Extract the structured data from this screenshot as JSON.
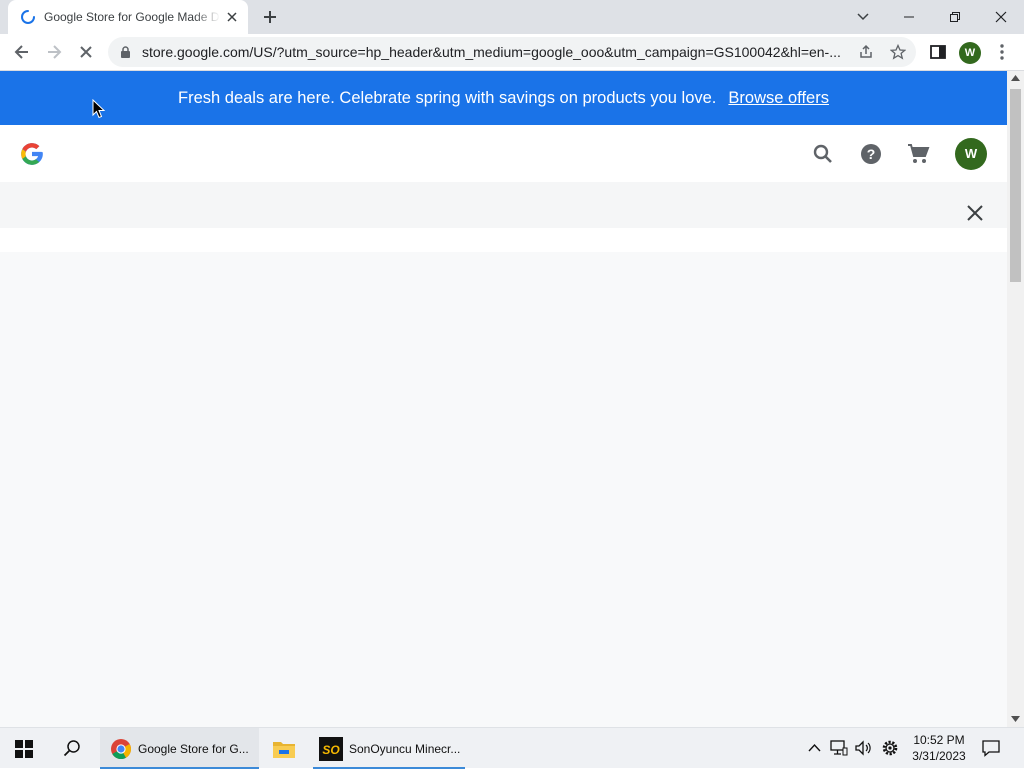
{
  "browser": {
    "tab_title": "Google Store for Google Made D",
    "url": "store.google.com/US/?utm_source=hp_header&utm_medium=google_ooo&utm_campaign=GS100042&hl=en-...",
    "profile_initial": "W"
  },
  "page": {
    "promo_text": "Fresh deals are here. Celebrate spring with savings on products you love.",
    "promo_link": "Browse offers",
    "account_initial": "W"
  },
  "taskbar": {
    "apps": [
      {
        "label": "Google Store for G...",
        "icon": "chrome-icon"
      },
      {
        "label": "",
        "icon": "file-explorer-icon"
      },
      {
        "label": "SonOyuncu Minecr...",
        "icon": "sonoyuncu-icon"
      }
    ],
    "time": "10:52 PM",
    "date": "3/31/2023"
  },
  "colors": {
    "promo_bg": "#1a73e8",
    "avatar_bg": "#33691e"
  }
}
